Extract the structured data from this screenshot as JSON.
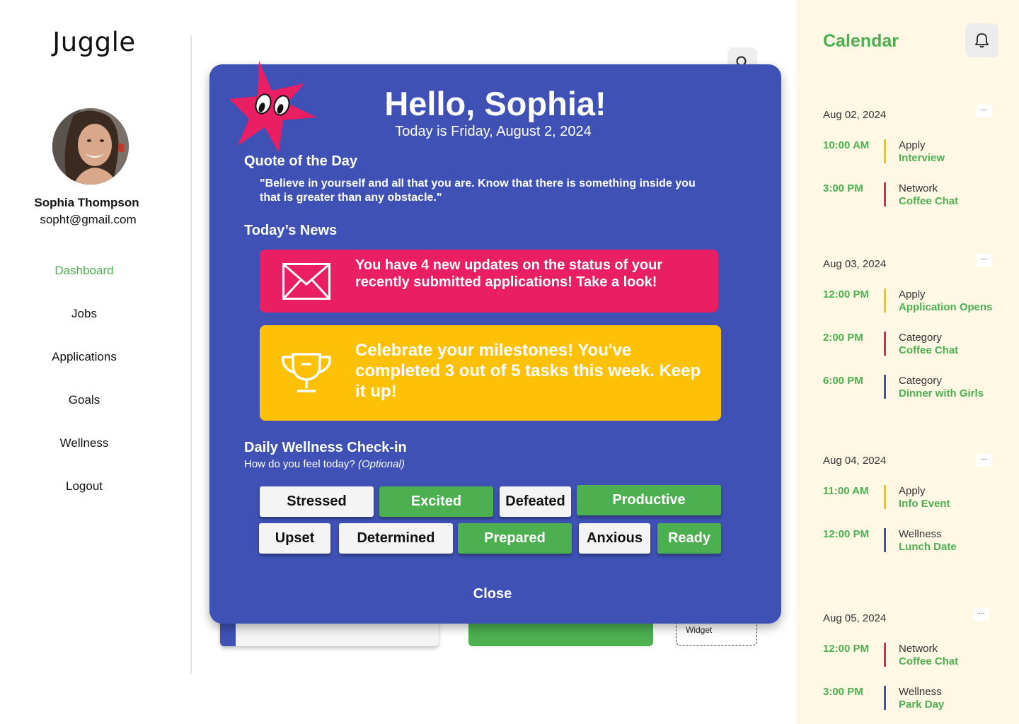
{
  "app": {
    "logo": "Juggle"
  },
  "user": {
    "name": "Sophia Thompson",
    "email": "sopht@gmail.com"
  },
  "nav": [
    {
      "label": "Dashboard",
      "active": true
    },
    {
      "label": "Jobs",
      "active": false
    },
    {
      "label": "Applications",
      "active": false
    },
    {
      "label": "Goals",
      "active": false
    },
    {
      "label": "Wellness",
      "active": false
    },
    {
      "label": "Logout",
      "active": false
    }
  ],
  "background": {
    "widget_label": "Widget"
  },
  "modal": {
    "greeting": "Hello, Sophia!",
    "date": "Today is Friday, August 2, 2024",
    "quote_title": "Quote of the Day",
    "quote": "\"Believe in yourself and all that you are. Know that there is something inside you that is greater than any obstacle.\"",
    "news_title": "Today’s News",
    "news": [
      {
        "text": "You have 4 new updates on the status of your recently submitted applications! Take a look!",
        "icon": "envelope-icon",
        "color": "#e91e63"
      },
      {
        "text": "Celebrate your milestones! You've completed 3 out of 5 tasks this week. Keep it up!",
        "icon": "trophy-icon",
        "color": "#ffc107"
      }
    ],
    "wellness_title": "Daily Wellness Check-in",
    "wellness_question": "How do you feel today?",
    "wellness_optional": "(Optional)",
    "moods": [
      {
        "label": "Stressed",
        "selected": false
      },
      {
        "label": "Excited",
        "selected": true
      },
      {
        "label": "Defeated",
        "selected": false
      },
      {
        "label": "Productive",
        "selected": true
      },
      {
        "label": "Upset",
        "selected": false
      },
      {
        "label": "Determined",
        "selected": false
      },
      {
        "label": "Prepared",
        "selected": true
      },
      {
        "label": "Anxious",
        "selected": false
      },
      {
        "label": "Ready",
        "selected": true
      }
    ],
    "close_label": "Close"
  },
  "calendar": {
    "title": "Calendar",
    "more_label": "...",
    "days": [
      {
        "date": "Aug 02, 2024",
        "events": [
          {
            "time": "10:00 AM",
            "category": "Apply",
            "name": "Interview",
            "color": "#ffc107"
          },
          {
            "time": "3:00 PM",
            "category": "Network",
            "name": "Coffee Chat",
            "color": "#e91e63"
          }
        ]
      },
      {
        "date": "Aug 03, 2024",
        "events": [
          {
            "time": "12:00 PM",
            "category": "Apply",
            "name": "Application Opens",
            "color": "#ffc107"
          },
          {
            "time": "2:00 PM",
            "category": "Category",
            "name": "Coffee Chat",
            "color": "#e91e63"
          },
          {
            "time": "6:00 PM",
            "category": "Category",
            "name": "Dinner with Girls",
            "color": "#3f51b5"
          }
        ]
      },
      {
        "date": "Aug 04, 2024",
        "events": [
          {
            "time": "11:00 AM",
            "category": "Apply",
            "name": "Info Event",
            "color": "#ffc107"
          },
          {
            "time": "12:00 PM",
            "category": "Wellness",
            "name": "Lunch Date",
            "color": "#3f51b5"
          }
        ]
      },
      {
        "date": "Aug 05, 2024",
        "events": [
          {
            "time": "12:00 PM",
            "category": "Network",
            "name": "Coffee Chat",
            "color": "#e91e63"
          },
          {
            "time": "3:00 PM",
            "category": "Wellness",
            "name": "Park Day",
            "color": "#3f51b5"
          }
        ]
      }
    ]
  },
  "colors": {
    "primary_blue": "#3f51b5",
    "accent_green": "#4caf50",
    "pink": "#e91e63",
    "yellow": "#ffc107",
    "calendar_bg": "#fff8e5"
  }
}
